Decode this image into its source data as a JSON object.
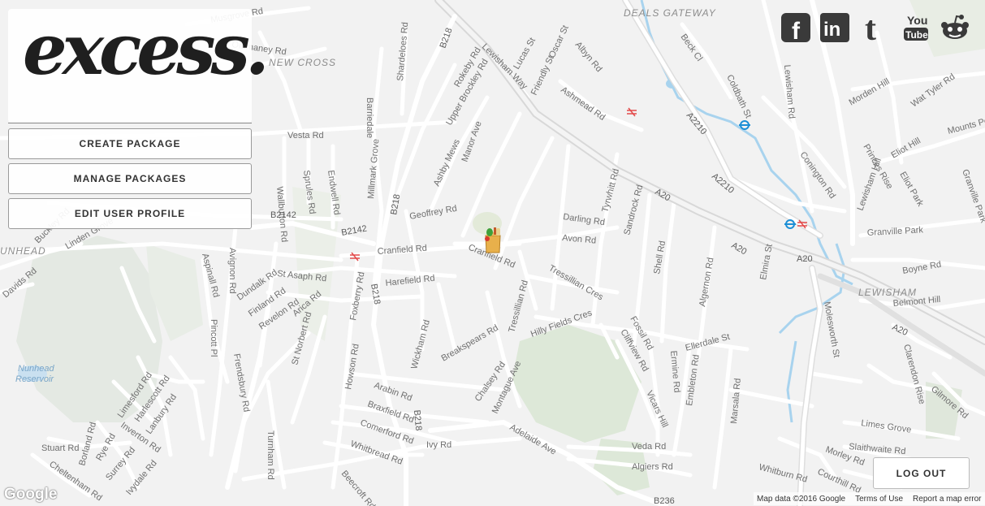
{
  "brand": {
    "logo_text": "excess."
  },
  "menu": {
    "create_package": "CREATE PACKAGE",
    "manage_packages": "MANAGE PACKAGES",
    "edit_user_profile": "EDIT USER PROFILE"
  },
  "social": {
    "facebook": "f",
    "linkedin": "in",
    "tumblr": "t",
    "youtube_top": "You",
    "youtube_bottom": "Tube",
    "reddit_icon": "reddit-icon"
  },
  "logout_label": "LOG OUT",
  "map": {
    "google_logo": "Google",
    "attribution": "Map data ©2016 Google",
    "terms": "Terms of Use",
    "report": "Report a map error",
    "areas": {
      "deals_gateway": "DEALS GATEWAY",
      "new_cross": "NEW CROSS",
      "nunhead": "UNHEAD",
      "lewisham": "LEWISHAM"
    },
    "water": {
      "reservoir_1": "Nunhead",
      "reservoir_2": "Reservoir"
    },
    "roads": {
      "r01": "Vesta Rd",
      "r02": "Wallbutton Rd",
      "r03": "Sprules Rd",
      "r04": "Endwell Rd",
      "r05": "Geoffrey Rd",
      "r06": "Cranfield Rd",
      "r07": "Cranfield Rd",
      "r08": "Harefield Rd",
      "r09": "St Asaph Rd",
      "r10": "Dundalk Rd",
      "r11": "Finland Rd",
      "r12": "Revelon Rd",
      "r13": "Arica Rd",
      "r14": "St Norbert Rd",
      "r15": "Foxberry Rd",
      "r16": "Howson Rd",
      "r17": "Arabin Rd",
      "r18": "Braxfield Rd",
      "r19": "Comerford Rd",
      "r20": "Whitbread Rd",
      "r21": "Ivy Rd",
      "r22": "Adelaide Ave",
      "r23": "Wickham Rd",
      "r24": "Breakspears Rd",
      "r25": "Tressillian Rd",
      "r26": "Hilly Fields Cres",
      "r27": "Tressillian Cres",
      "r28": "Darling Rd",
      "r29": "Avon Rd",
      "r30": "Tyrwhitt Rd",
      "r31": "Sandrock Rd",
      "r32": "Shell Rd",
      "r33": "Algernon Rd",
      "r34": "Fossil Rd",
      "r35": "Cliffview Rd",
      "r36": "Ermine Rd",
      "r37": "Embleton Rd",
      "r38": "Ellerdale St",
      "r39": "Vicars Hill",
      "r40": "Marsala Rd",
      "r41": "Veda Rd",
      "r42": "Algiers Rd",
      "r43": "Whitburn Rd",
      "r44": "Courthill Rd",
      "r45": "Morley Rd",
      "r46": "Slaithwaite Rd",
      "r47": "Limes Grove",
      "r48": "Molesworth St",
      "r49": "Belmont Hill",
      "r50": "Clarendon Rise",
      "r51": "Gilmore Rd",
      "r52": "Boyne Rd",
      "r53": "Granville Park",
      "r54": "Lewisham Hill",
      "r55": "Eliot Park",
      "r56": "Eliot Hill",
      "r57": "Lewisham Rd",
      "r58": "Morden Hill",
      "r59": "Wat Tyler Rd",
      "r60": "Conington Rd",
      "r61": "Coldbath St",
      "r62": "Beck Cl",
      "r63": "Lewisham Way",
      "r64": "Albyn Rd",
      "r65": "Ashmead Rd",
      "r66": "Friendly St",
      "r67": "Oscar St",
      "r68": "Lucas St",
      "r69": "Rokeby Rd",
      "r70": "Upper Brockley Rd",
      "r71": "Ashby Mews",
      "r72": "Manor Ave",
      "r73": "Millmark Grove",
      "r74": "Shardeloes Rd",
      "r75": "Barriedale",
      "r76": "Limesford Rd",
      "r77": "Harlescott Rd",
      "r78": "Lanbury Rd",
      "r79": "Inverton Rd",
      "r80": "Stuart Rd",
      "r81": "Borland Rd",
      "r82": "Rye Rd",
      "r83": "Surrey Rd",
      "r84": "Ivydale Rd",
      "r85": "Cheltenham Rd",
      "r86": "Frendsbury Rd",
      "r87": "Pincott Pl",
      "r88": "Aspinall Rd",
      "r89": "Turnham Rd",
      "r90": "Beecroft Rd",
      "r91": "Chalsey Rd",
      "r92": "Montague Ave",
      "r93": "Buckley Rd",
      "r94": "Linden Grove",
      "r95": "Davids Rd",
      "r96": "Avignon Rd",
      "r97": "Mounts Pond Rd",
      "r98": "Princes Rise",
      "r99": "Musgrove Rd",
      "r100": "Ommaney Rd",
      "r101": "Elmira St",
      "r102": "Granville Park"
    },
    "route_shields": {
      "b218_a": "B218",
      "b218_b": "B218",
      "b218_c": "B218",
      "b218_d": "B218",
      "b2142_a": "B2142",
      "b2142_b": "B2142",
      "a20_a": "A20",
      "a20_b": "A20",
      "a20_c": "A20",
      "a20_d": "A20",
      "a2210_a": "A2210",
      "a2210_b": "A2210",
      "b236": "B236"
    }
  }
}
